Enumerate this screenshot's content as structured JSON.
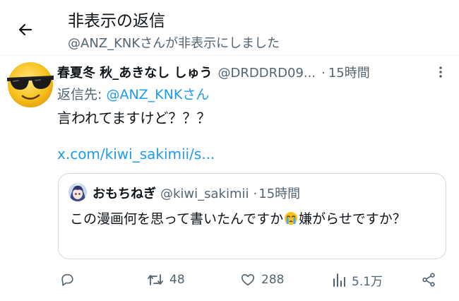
{
  "header": {
    "title": "非表示の返信",
    "subtitle": "@ANZ_KNKさんが非表示にしました"
  },
  "tweet": {
    "display_name": "春夏冬 秋_あきなし しゅう",
    "handle": "@DRDDRD09...",
    "separator": "·",
    "time": "15時間",
    "reply_label": "返信先: ",
    "reply_to": "@ANZ_KNKさん",
    "text": "言われてますけど？？？",
    "link": "x.com/kiwi_sakimii/s..."
  },
  "quote": {
    "display_name": "おもちねぎ",
    "handle": "@kiwi_sakimii",
    "separator": "·",
    "time": "15時間",
    "text_before": "この漫画何を思って書いたんですか",
    "text_after": "嫌がらせですか？"
  },
  "actions": {
    "retweets": "48",
    "likes": "288",
    "views": "5.1万"
  },
  "colors": {
    "accent": "#1d9bf0",
    "secondary_text": "#536471",
    "border": "#cfd9de"
  },
  "icons": [
    "back-arrow-icon",
    "more-icon",
    "reply-icon",
    "retweet-icon",
    "like-icon",
    "views-icon",
    "share-icon",
    "sunglasses-emoji",
    "crying-emoji"
  ]
}
